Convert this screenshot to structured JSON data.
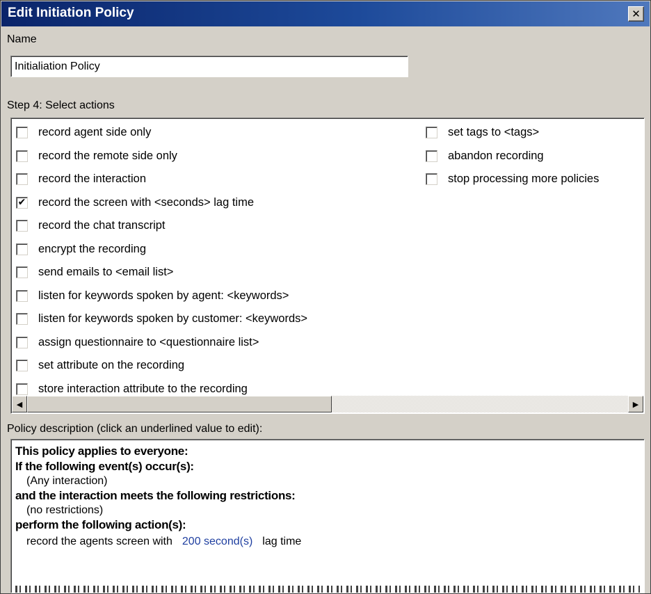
{
  "window": {
    "title": "Edit Initiation Policy",
    "close_glyph": "✕"
  },
  "name_section": {
    "label": "Name",
    "value": "Initialiation Policy"
  },
  "actions_section": {
    "label": "Step 4: Select actions",
    "left_column": [
      {
        "label": "record agent side only",
        "checked": false
      },
      {
        "label": "record the remote side only",
        "checked": false
      },
      {
        "label": "record the interaction",
        "checked": false
      },
      {
        "label": "record the screen with <seconds> lag time",
        "checked": true
      },
      {
        "label": "record the chat transcript",
        "checked": false
      },
      {
        "label": "encrypt the recording",
        "checked": false
      },
      {
        "label": "send emails to <email list>",
        "checked": false
      },
      {
        "label": "listen for keywords spoken by agent: <keywords>",
        "checked": false
      },
      {
        "label": "listen for keywords spoken by customer: <keywords>",
        "checked": false
      },
      {
        "label": "assign questionnaire to <questionnaire list>",
        "checked": false
      },
      {
        "label": "set attribute on the recording",
        "checked": false
      },
      {
        "label": "store interaction attribute to the recording",
        "checked": false
      }
    ],
    "right_column": [
      {
        "label": "set tags to <tags>",
        "checked": false
      },
      {
        "label": "abandon recording",
        "checked": false
      },
      {
        "label": "stop processing more policies",
        "checked": false
      }
    ],
    "check_glyph": "✔",
    "scroll_left_glyph": "◀",
    "scroll_right_glyph": "▶"
  },
  "description_section": {
    "label": "Policy description (click an underlined value to edit):",
    "line_applies": "This policy applies to everyone:",
    "line_events_heading": "If the following event(s) occur(s):",
    "line_events_value": "(Any interaction)",
    "line_restrictions_heading": "and the interaction meets the following restrictions:",
    "line_restrictions_value": "(no restrictions)",
    "line_actions_heading": "perform the following action(s):",
    "action_prefix": "record the agents screen with",
    "action_value": "200 second(s)",
    "action_suffix": "lag time"
  },
  "colors": {
    "title_bar": "#0a246a",
    "dialog_face": "#d4d0c8",
    "link_value": "#1f3fa0"
  },
  "icons": {
    "close": "close-icon",
    "check": "checkmark-icon",
    "scroll_left": "arrow-left-icon",
    "scroll_right": "arrow-right-icon"
  }
}
